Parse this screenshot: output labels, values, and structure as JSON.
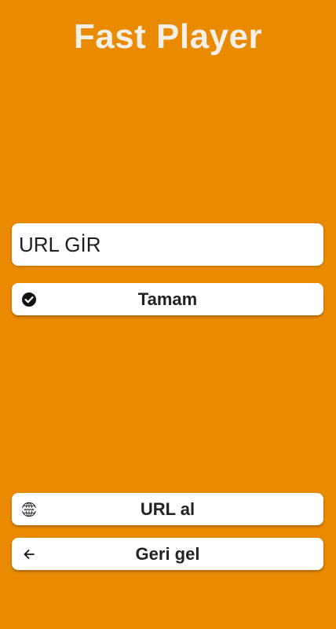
{
  "app": {
    "title": "Fast Player"
  },
  "url_input": {
    "placeholder": "URL GİR",
    "value": ""
  },
  "buttons": {
    "ok_label": "Tamam",
    "get_url_label": "URL al",
    "back_label": "Geri gel"
  },
  "icons": {
    "ok": "check-circle-icon",
    "get_url": "www-globe-icon",
    "back": "arrow-left-icon"
  },
  "colors": {
    "background": "#e98a00",
    "title": "#f5efe6",
    "button_bg": "#ffffff",
    "button_text": "#222222"
  }
}
